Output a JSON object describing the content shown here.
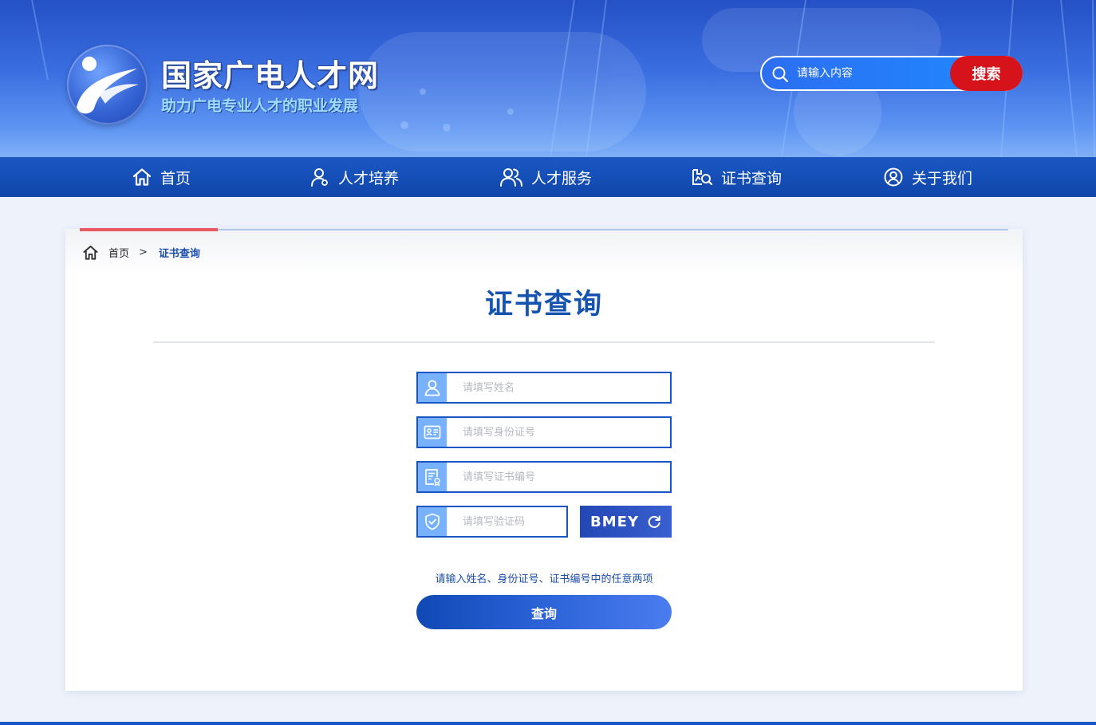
{
  "header": {
    "site_title": "国家广电人才网",
    "site_subtitle": "助力广电专业人才的职业发展",
    "search": {
      "placeholder": "请输入内容",
      "button_label": "搜索"
    }
  },
  "nav": {
    "items": [
      {
        "label": "首页",
        "icon": "home-icon"
      },
      {
        "label": "人才培养",
        "icon": "user-icon"
      },
      {
        "label": "人才服务",
        "icon": "users-icon"
      },
      {
        "label": "证书查询",
        "icon": "certificate-search-icon"
      },
      {
        "label": "关于我们",
        "icon": "user-circle-icon"
      }
    ]
  },
  "breadcrumb": {
    "home": "首页",
    "separator": ">",
    "current": "证书查询"
  },
  "page": {
    "title": "证书查询"
  },
  "form": {
    "name_placeholder": "请填写姓名",
    "id_placeholder": "请填写身份证号",
    "cert_placeholder": "请填写证书编号",
    "captcha_placeholder": "请填写验证码",
    "captcha_code": "BMEY",
    "hint": "请输入姓名、身份证号、证书编号中的任意两项",
    "submit_label": "查询"
  },
  "colors": {
    "primary": "#1a56c3",
    "nav_bg": "#1250b8",
    "search_button": "#d6121b",
    "accent_red": "#e85a5f",
    "icon_box": "#78b2ff",
    "title_blue": "#1453b0"
  }
}
